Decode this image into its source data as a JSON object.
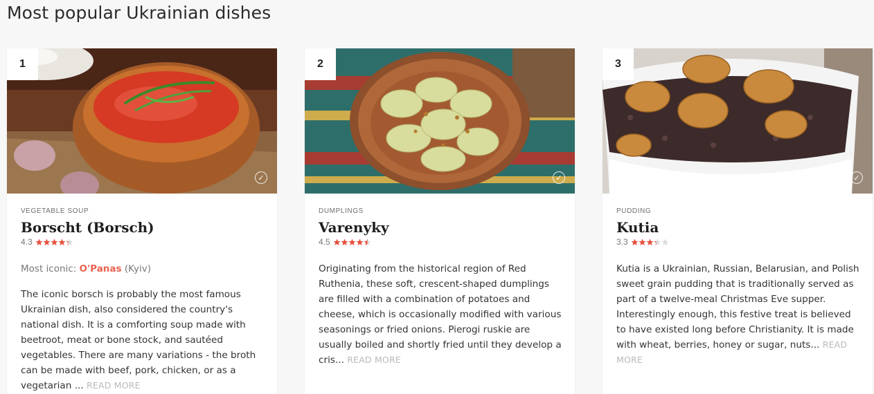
{
  "page": {
    "title": "Most popular Ukrainian dishes"
  },
  "cards": [
    {
      "rank": "1",
      "category": "VEGETABLE SOUP",
      "name": "Borscht (Borsch)",
      "rating": 4.3,
      "rating_label": "4.3",
      "iconic_label": "Most iconic:",
      "iconic_restaurant": "O'Panas",
      "iconic_city": "(Kyiv)",
      "description": "The iconic borsch is probably the most famous Ukrainian dish, also considered the country's national dish. It is a comforting soup made with beetroot, meat or bone stock, and sautéed vegetables. There are many variations - the broth can be made with beef, pork, chicken, or as a vegetarian ...",
      "read_more": "READ MORE",
      "image_icon": "borscht-photo"
    },
    {
      "rank": "2",
      "category": "DUMPLINGS",
      "name": "Varenyky",
      "rating": 4.5,
      "rating_label": "4.5",
      "description": "Originating from the historical region of Red Ruthenia, these soft, crescent-shaped dumplings are filled with a combination of potatoes and cheese, which is occasionally modified with various seasonings or fried onions. Pierogi ruskie are usually boiled and shortly fried until they develop a cris...",
      "read_more": "READ MORE",
      "image_icon": "varenyky-photo"
    },
    {
      "rank": "3",
      "category": "PUDDING",
      "name": "Kutia",
      "rating": 3.3,
      "rating_label": "3.3",
      "description": "Kutia is a Ukrainian, Russian, Belarusian, and Polish sweet grain pudding that is traditionally served as part of a twelve-meal Christmas Eve supper. Interestingly enough, this festive treat is believed to have existed long before Christianity. It is made with wheat, berries, honey or sugar, nuts...",
      "read_more": "READ MORE",
      "image_icon": "kutia-photo"
    }
  ],
  "colors": {
    "star_filled": "#e8503f",
    "star_empty": "#dcdcdc",
    "accent": "#e8624f",
    "read_more": "#b9b9b9",
    "page_bg": "#f7f7f7"
  }
}
